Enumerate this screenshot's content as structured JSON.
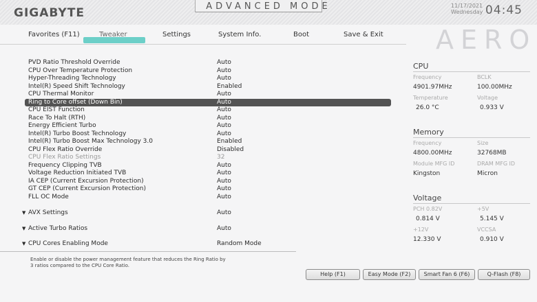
{
  "brand": "GIGABYTE",
  "mode_title": "ADVANCED MODE",
  "date": "11/17/2021",
  "weekday": "Wednesday",
  "time": "04:45",
  "aero_logo": "AERO",
  "tabs": [
    {
      "label": "Favorites (F11)"
    },
    {
      "label": "Tweaker"
    },
    {
      "label": "Settings"
    },
    {
      "label": "System Info."
    },
    {
      "label": "Boot"
    },
    {
      "label": "Save & Exit"
    }
  ],
  "settings": [
    {
      "label": "PVD Ratio Threshold Override",
      "value": "Auto"
    },
    {
      "label": "CPU Over Temperature Protection",
      "value": "Auto"
    },
    {
      "label": "Hyper-Threading Technology",
      "value": "Auto"
    },
    {
      "label": "Intel(R) Speed Shift Technology",
      "value": "Enabled"
    },
    {
      "label": "CPU Thermal Monitor",
      "value": "Auto"
    },
    {
      "label": "Ring to Core offset (Down Bin)",
      "value": "Auto"
    },
    {
      "label": "CPU EIST Function",
      "value": "Auto"
    },
    {
      "label": "Race To Halt (RTH)",
      "value": "Auto"
    },
    {
      "label": "Energy Efficient Turbo",
      "value": "Auto"
    },
    {
      "label": "Intel(R) Turbo Boost Technology",
      "value": "Auto"
    },
    {
      "label": "Intel(R) Turbo Boost Max Technology 3.0",
      "value": "Enabled"
    },
    {
      "label": "CPU Flex Ratio Override",
      "value": "Disabled"
    },
    {
      "label": "CPU Flex Ratio Settings",
      "value": "32"
    },
    {
      "label": "Frequency Clipping TVB",
      "value": "Auto"
    },
    {
      "label": "Voltage Reduction Initiated TVB",
      "value": "Auto"
    },
    {
      "label": "IA CEP (Current Excursion Protection)",
      "value": "Auto"
    },
    {
      "label": "GT CEP (Current Excursion Protection)",
      "value": "Auto"
    },
    {
      "label": "FLL OC Mode",
      "value": "Auto"
    }
  ],
  "submenus": [
    {
      "label": "AVX Settings",
      "value": "Auto"
    },
    {
      "label": "Active Turbo Ratios",
      "value": "Auto"
    },
    {
      "label": "CPU Cores Enabling Mode",
      "value": "Random Mode"
    }
  ],
  "help_text_line1": "Enable or disable the power management feature that reduces the Ring Ratio by",
  "help_text_line2": "3 ratios compared to the CPU Core Ratio.",
  "cpu": {
    "title": "CPU",
    "frequency_label": "Frequency",
    "frequency_value": "4901.97MHz",
    "bclk_label": "BCLK",
    "bclk_value": "100.00MHz",
    "temperature_label": "Temperature",
    "temperature_value": "26.0 °C",
    "voltage_label": "Voltage",
    "voltage_value": "0.933 V"
  },
  "memory": {
    "title": "Memory",
    "frequency_label": "Frequency",
    "frequency_value": "4800.00MHz",
    "size_label": "Size",
    "size_value": "32768MB",
    "module_label": "Module MFG ID",
    "module_value": "Kingston",
    "dram_label": "DRAM MFG ID",
    "dram_value": "Micron"
  },
  "voltage": {
    "title": "Voltage",
    "pch_label": "PCH 0.82V",
    "pch_value": "0.814 V",
    "p5v_label": "+5V",
    "p5v_value": "5.145 V",
    "p12v_label": "+12V",
    "p12v_value": "12.330 V",
    "vccsa_label": "VCCSA",
    "vccsa_value": "0.910 V"
  },
  "buttons": {
    "help": "Help (F1)",
    "easy": "Easy Mode (F2)",
    "smartfan": "Smart Fan 6 (F6)",
    "qflash": "Q-Flash (F8)"
  },
  "colors": {
    "accent": "#6ccfc8",
    "selected_row": "#535353"
  }
}
